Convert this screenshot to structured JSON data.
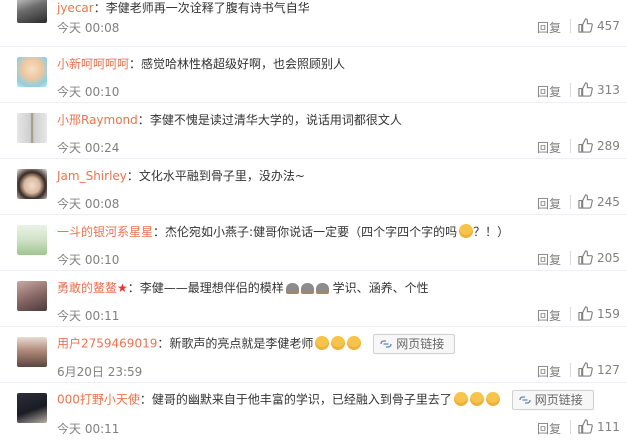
{
  "comments": [
    {
      "user": "jyecar",
      "text": "李健老师再一次诠释了腹有诗书气自华",
      "time": "今天 00:08",
      "reply": "回复",
      "likes": "457"
    },
    {
      "user": "小新呵呵呵呵",
      "text": "感觉哈林性格超级好啊，也会照顾别人",
      "time": "今天 00:10",
      "reply": "回复",
      "likes": "313"
    },
    {
      "user": "小邢Raymond",
      "text": "李健不愧是读过清华大学的，说话用词都很文人",
      "time": "今天 00:24",
      "reply": "回复",
      "likes": "289"
    },
    {
      "user": "Jam_Shirley",
      "text": "文化水平融到骨子里，没办法~",
      "time": "今天 00:08",
      "reply": "回复",
      "likes": "245"
    },
    {
      "user": "一斗的银河系星星",
      "text_a": "杰伦宛如小燕子:健哥你说话一定要（四个字四个字的吗",
      "text_b": "？！）",
      "time": "今天 00:10",
      "reply": "回复",
      "likes": "205"
    },
    {
      "user": "勇敢的鳌鳌",
      "text_a": "李健——最理想伴侣的模样",
      "text_b": "学识、涵养、个性",
      "time": "今天 00:11",
      "reply": "回复",
      "likes": "159"
    },
    {
      "user": "用户2759469019",
      "text": "新歌声的亮点就是李健老师",
      "link": "网页链接",
      "time": "6月20日 23:59",
      "reply": "回复",
      "likes": "127"
    },
    {
      "user": "000打野小天使",
      "text": "健哥的幽默来自于他丰富的学识，已经融入到骨子里去了",
      "link": "网页链接",
      "time": "今天 00:11",
      "reply": "回复",
      "likes": "111"
    }
  ],
  "colors": {
    "username": "#eb7350",
    "meta": "#808080",
    "text": "#333333"
  }
}
